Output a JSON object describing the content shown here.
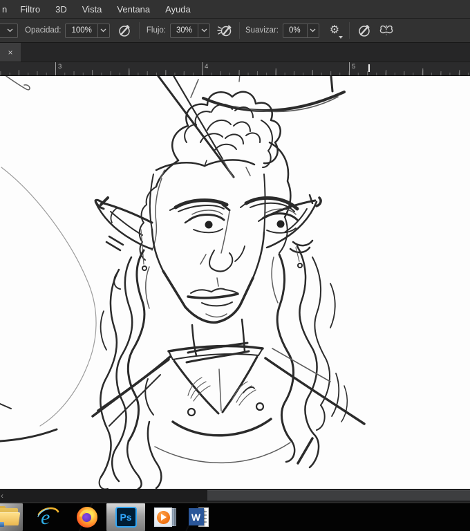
{
  "menubar": {
    "items": [
      "n",
      "Filtro",
      "3D",
      "Vista",
      "Ventana",
      "Ayuda"
    ]
  },
  "options_bar": {
    "opacity": {
      "label": "Opacidad:",
      "value": "100%"
    },
    "flow": {
      "label": "Flujo:",
      "value": "30%"
    },
    "smoothing": {
      "label": "Suavizar:",
      "value": "0%"
    },
    "icons": {
      "tool_preset_chevron": "chevron-down",
      "opacity_pressure": "pen-pressure",
      "airbrush": "airbrush",
      "smoothing_options": "gear",
      "gear_glyph": "⚙",
      "flow_pressure": "pen-pressure",
      "symmetry": "butterfly"
    }
  },
  "tab_bar": {
    "close_label": "×"
  },
  "ruler": {
    "labels": [
      "3",
      "4",
      "5"
    ],
    "cursor_marker": true
  },
  "canvas": {
    "content": "hand-drawn monochrome sketch of a male elf with a curly topknot, long wavy hair, pointed pierced ears and an ornate high-collar garment"
  },
  "scrollbar": {
    "left_arrow": "‹"
  },
  "taskbar": {
    "items": [
      {
        "id": "file-explorer",
        "open": true
      },
      {
        "id": "internet-explorer",
        "glyph": "e",
        "open": false
      },
      {
        "id": "firefox",
        "open": false
      },
      {
        "id": "photoshop",
        "glyph": "Ps",
        "open": true,
        "active": true
      },
      {
        "id": "media-player",
        "open": false
      },
      {
        "id": "word",
        "glyph": "W",
        "open": false
      }
    ]
  },
  "colors": {
    "ui_bg": "#323232",
    "canvas_bg": "#fdfdfd",
    "sketch_ink": "#2b2b2b",
    "ps_accent": "#31a8ff",
    "ps_tile_bg": "#001d34",
    "ie_blue": "#2fb1ea",
    "firefox_orange": "#ff8a2a",
    "wmp_orange": "#ee7011",
    "word_blue": "#2b579a",
    "taskbar_bg": "#030303"
  }
}
